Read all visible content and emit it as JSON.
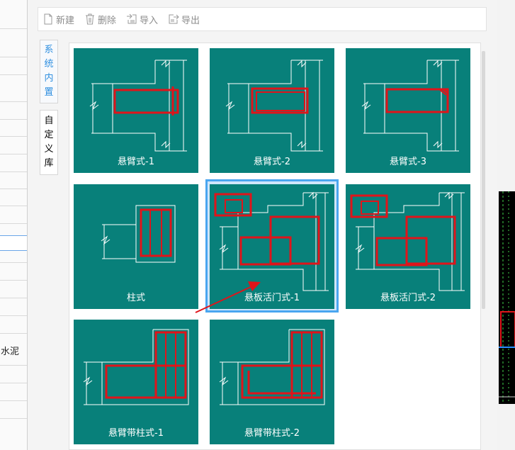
{
  "toolbar": {
    "new_label": "新建",
    "delete_label": "删除",
    "import_label": "导入",
    "export_label": "导出"
  },
  "side_tabs": [
    {
      "label": [
        "系",
        "统",
        "内",
        "置"
      ],
      "active": true
    },
    {
      "label": [
        "自",
        "定",
        "义",
        "库"
      ],
      "active": false
    }
  ],
  "cards": [
    {
      "label": "悬臂式-1",
      "selected": false
    },
    {
      "label": "悬臂式-2",
      "selected": false
    },
    {
      "label": "悬臂式-3",
      "selected": false
    },
    {
      "label": "柱式",
      "selected": false
    },
    {
      "label": "悬板活门式-1",
      "selected": true
    },
    {
      "label": "悬板活门式-2",
      "selected": false
    },
    {
      "label": "悬臂带柱式-1",
      "selected": false
    },
    {
      "label": "悬臂带柱式-2",
      "selected": false
    }
  ],
  "background": {
    "left_text": "水泥"
  },
  "colors": {
    "card_bg": "#08807a",
    "rebar": "#e0141a",
    "selection": "#4aa6f0",
    "active_tab": "#2f8fe0"
  }
}
